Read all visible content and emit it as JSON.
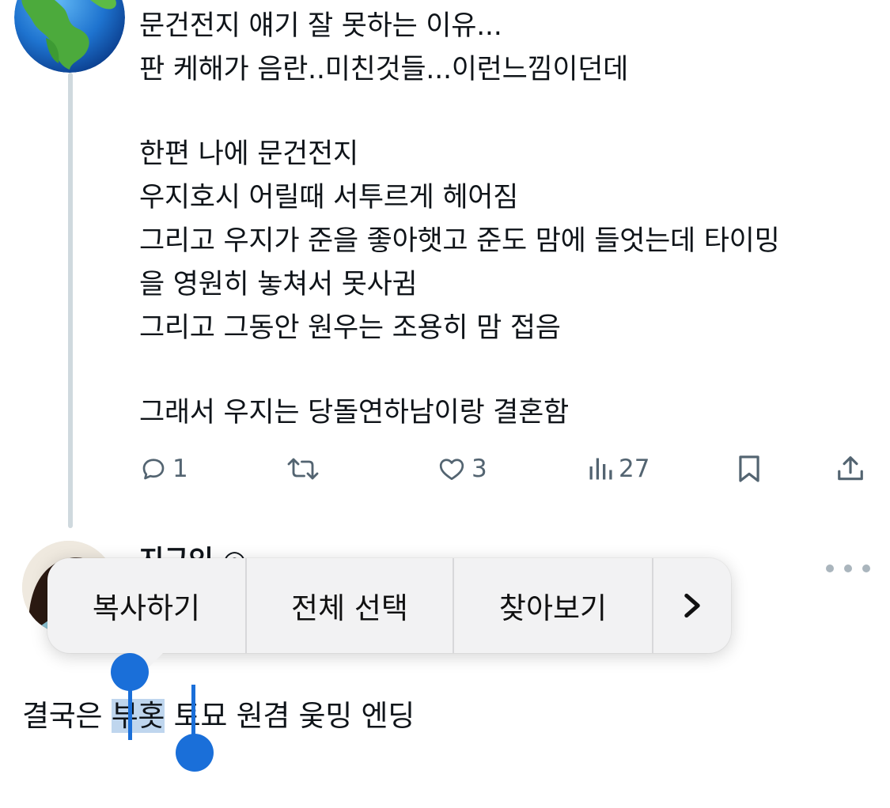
{
  "tweet": {
    "lines": [
      "문건전지 얘기 잘 못하는 이유...",
      "판 케해가 음란..미친것들...이런느낌이던데",
      "",
      "한편 나에 문건전지",
      "우지호시 어릴때 서투르게 헤어짐",
      "그리고 우지가 준을 좋아햇고 준도 맘에 들엇는데 타이밍",
      "을 영원히 놓쳐서 못사귐",
      "그리고 그동안 원우는 조용히 맘 접음",
      "",
      "그래서 우지는 당돌연하남이랑 결혼함"
    ],
    "actions": {
      "reply_count": "1",
      "retweet_count": "",
      "like_count": "3",
      "views_count": "27"
    }
  },
  "reply": {
    "username_partial": "지구인 ◎",
    "text_before": "결국은 ",
    "text_selected": "부홋",
    "text_after": " 토묘 원겸 웆밍 엔딩"
  },
  "edit_menu": {
    "items": [
      "복사하기",
      "전체 선택",
      "찾아보기"
    ],
    "more": "›"
  },
  "colors": {
    "accent": "#1a6fd9",
    "selection": "#bfd6ee",
    "icon_gray": "#536471",
    "thread_line": "#cfd9de"
  },
  "icons": [
    "globe-avatar",
    "reply-icon",
    "retweet-icon",
    "like-icon",
    "views-icon",
    "bookmark-icon",
    "share-icon",
    "more-icon",
    "chevron-right-icon"
  ]
}
